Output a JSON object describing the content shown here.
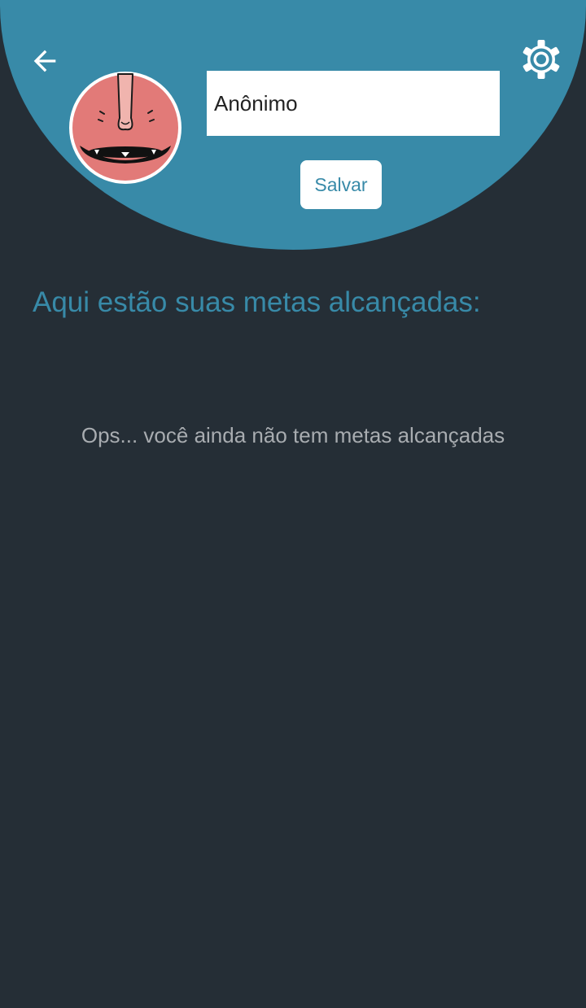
{
  "header": {
    "back_icon": "arrow-left-icon",
    "settings_icon": "gear-icon",
    "avatar_icon": "pink-face-avatar",
    "name_value": "Anônimo",
    "save_label": "Salvar"
  },
  "main": {
    "section_title": "Aqui estão suas metas alcançadas:",
    "empty_message": "Ops... você ainda não tem metas alcançadas"
  },
  "colors": {
    "background": "#252e36",
    "header": "#388aa8",
    "accent": "#388aa8",
    "muted_text": "#a8acb0",
    "avatar_face": "#e27a78"
  }
}
